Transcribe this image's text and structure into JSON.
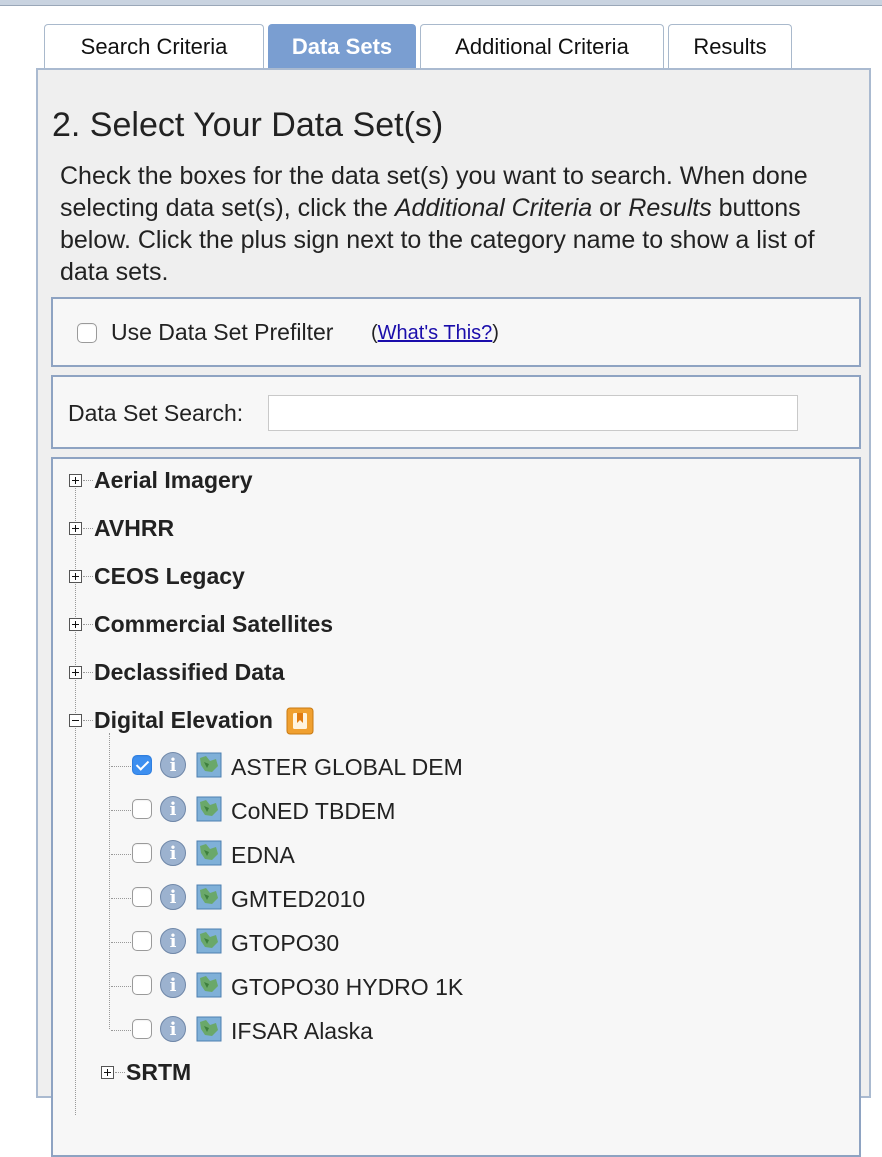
{
  "tabs": [
    {
      "label": "Search Criteria"
    },
    {
      "label": "Data Sets"
    },
    {
      "label": "Additional Criteria"
    },
    {
      "label": "Results"
    }
  ],
  "active_tab": "Data Sets",
  "main": {
    "title": "2. Select Your Data Set(s)",
    "instructions": {
      "part1": "Check the boxes for the data set(s) you want to search. When done selecting data set(s), click the ",
      "emph1": "Additional Criteria",
      "part2": " or ",
      "emph2": "Results",
      "part3": " buttons below. Click the plus sign next to the category name to show a list of data sets."
    }
  },
  "prefilter": {
    "label": "Use Data Set Prefilter",
    "open_paren": "(",
    "link_text": "What's This?",
    "close_paren": ")",
    "checked": false
  },
  "search": {
    "label": "Data Set Search:",
    "value": "",
    "placeholder": ""
  },
  "tree": {
    "categories": [
      {
        "label": "Aerial Imagery",
        "expanded": false
      },
      {
        "label": "AVHRR",
        "expanded": false
      },
      {
        "label": "CEOS Legacy",
        "expanded": false
      },
      {
        "label": "Commercial Satellites",
        "expanded": false
      },
      {
        "label": "Declassified Data",
        "expanded": false
      },
      {
        "label": "Digital Elevation",
        "expanded": true
      }
    ],
    "items": [
      {
        "label": "ASTER GLOBAL DEM",
        "checked": true
      },
      {
        "label": "CoNED TBDEM",
        "checked": false
      },
      {
        "label": "EDNA",
        "checked": false
      },
      {
        "label": "GMTED2010",
        "checked": false
      },
      {
        "label": "GTOPO30",
        "checked": false
      },
      {
        "label": "GTOPO30 HYDRO 1K",
        "checked": false
      },
      {
        "label": "IFSAR Alaska",
        "checked": false
      }
    ],
    "subcategory": {
      "label": "SRTM",
      "expanded": false
    }
  },
  "icons": {
    "info": "info-icon",
    "map": "map-preview-icon",
    "category_action": "orange-bookmark-icon",
    "expand": "plus-icon",
    "collapse": "minus-icon"
  },
  "colors": {
    "active_tab": "#7a9ed1",
    "panel_border": "#aabad0",
    "box_border": "#8ea3c2",
    "link": "#1a0dab",
    "checkbox_checked": "#3d8ff0",
    "category_icon": "#f0a030"
  }
}
